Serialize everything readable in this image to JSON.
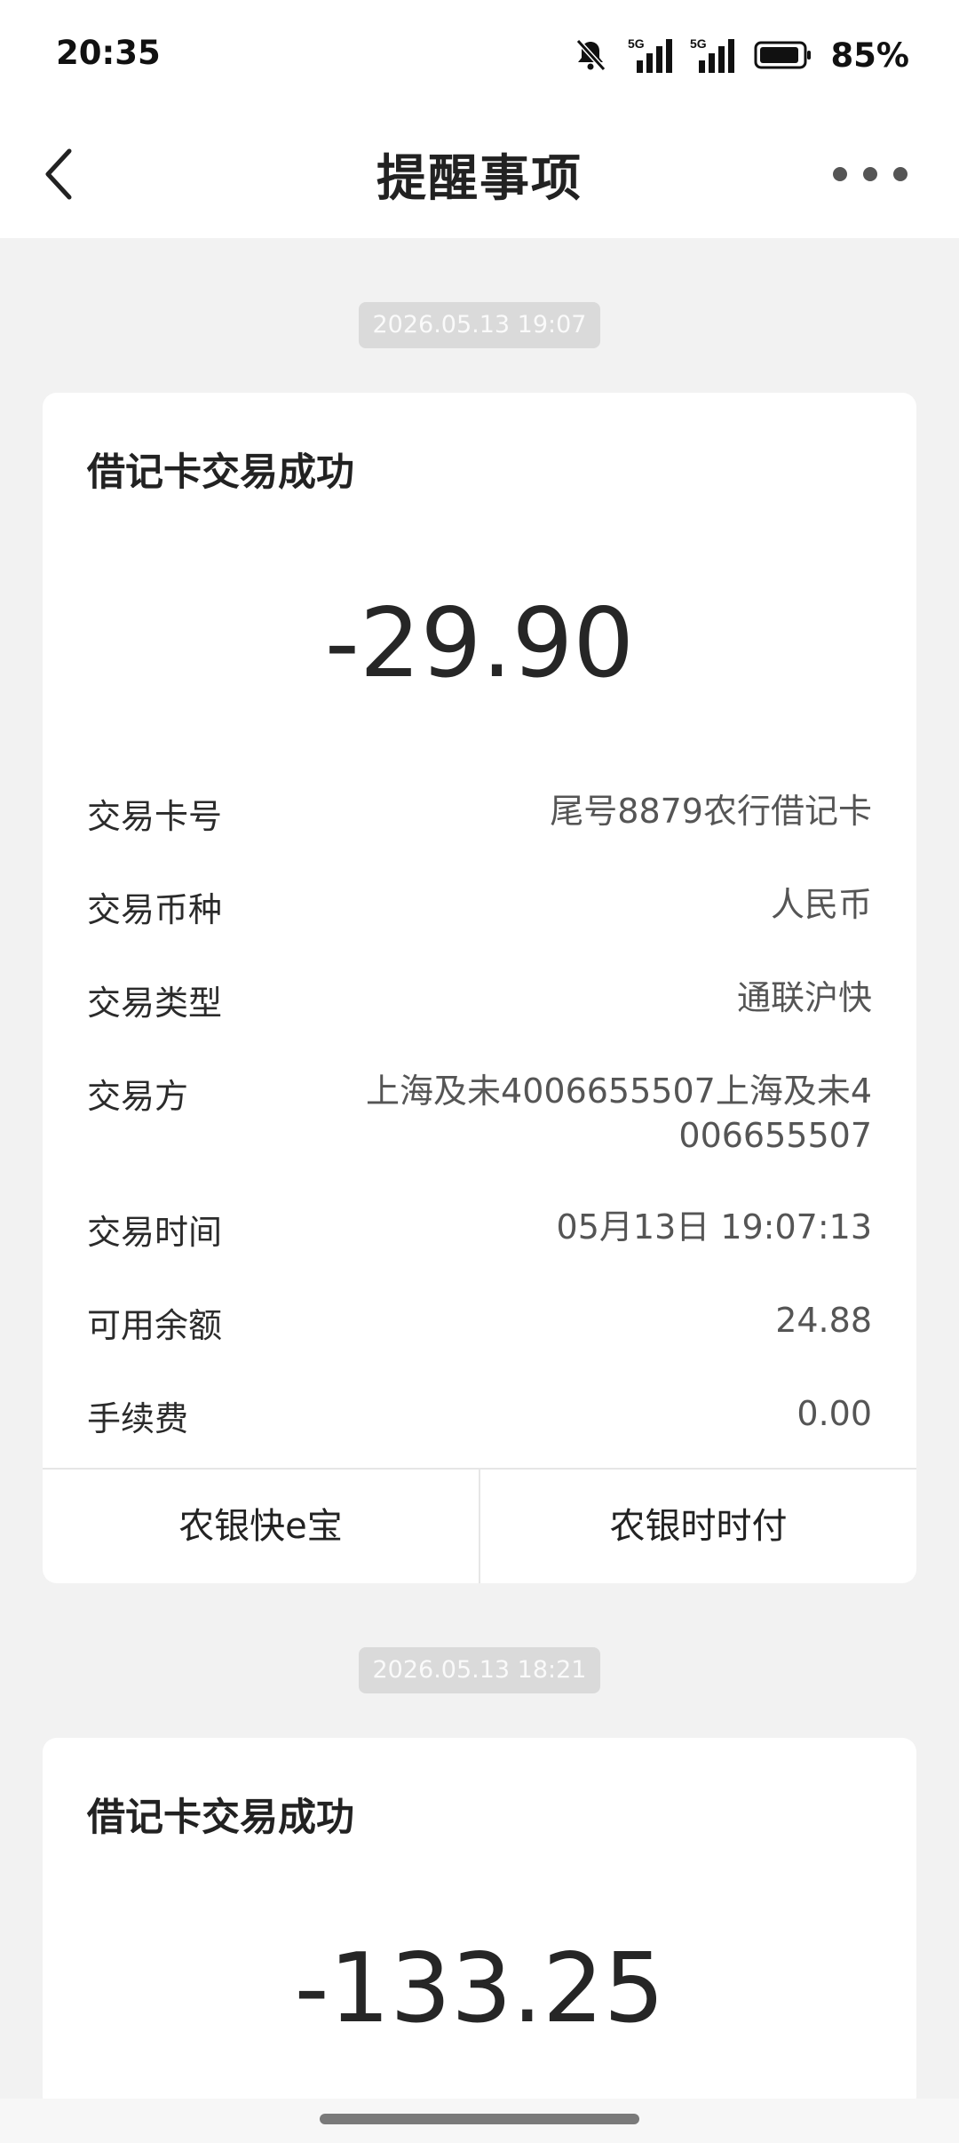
{
  "status_bar": {
    "time": "20:35",
    "signal1_label": "5G",
    "signal2_label": "5G",
    "battery": "85%"
  },
  "header": {
    "title": "提醒事项"
  },
  "messages": [
    {
      "timestamp": "2026.05.13 19:07",
      "title": "借记卡交易成功",
      "amount": "-29.90",
      "rows": [
        {
          "label": "交易卡号",
          "value": "尾号8879农行借记卡"
        },
        {
          "label": "交易币种",
          "value": "人民币"
        },
        {
          "label": "交易类型",
          "value": "通联沪快"
        },
        {
          "label": "交易方",
          "value": "上海及未4006655507上海及未4006655507"
        },
        {
          "label": "交易时间",
          "value": "05月13日 19:07:13"
        },
        {
          "label": "可用余额",
          "value": "24.88"
        },
        {
          "label": "手续费",
          "value": "0.00"
        }
      ],
      "actions": [
        "农银快e宝",
        "农银时时付"
      ]
    },
    {
      "timestamp": "2026.05.13 18:21",
      "title": "借记卡交易成功",
      "amount": "-133.25"
    }
  ]
}
